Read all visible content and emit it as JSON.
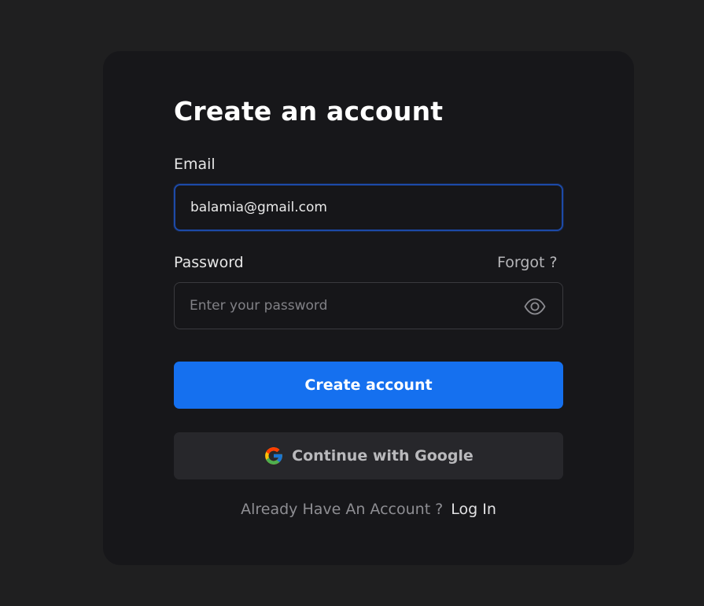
{
  "form": {
    "title": "Create an account",
    "email": {
      "label": "Email",
      "value": "balamia@gmail.com"
    },
    "password": {
      "label": "Password",
      "placeholder": "Enter your password",
      "forgot_label": "Forgot ?",
      "toggle_icon": "eye-icon"
    },
    "submit_label": "Create account",
    "google_label": "Continue with Google",
    "google_icon": "google-icon",
    "footer": {
      "prompt": "Already Have An Account ?",
      "login_label": "Log In"
    }
  },
  "colors": {
    "background": "#1f1f20",
    "card": "#17171a",
    "primary": "#1570ef",
    "focus_border": "#1d4aa8",
    "google_button": "#27272b"
  }
}
